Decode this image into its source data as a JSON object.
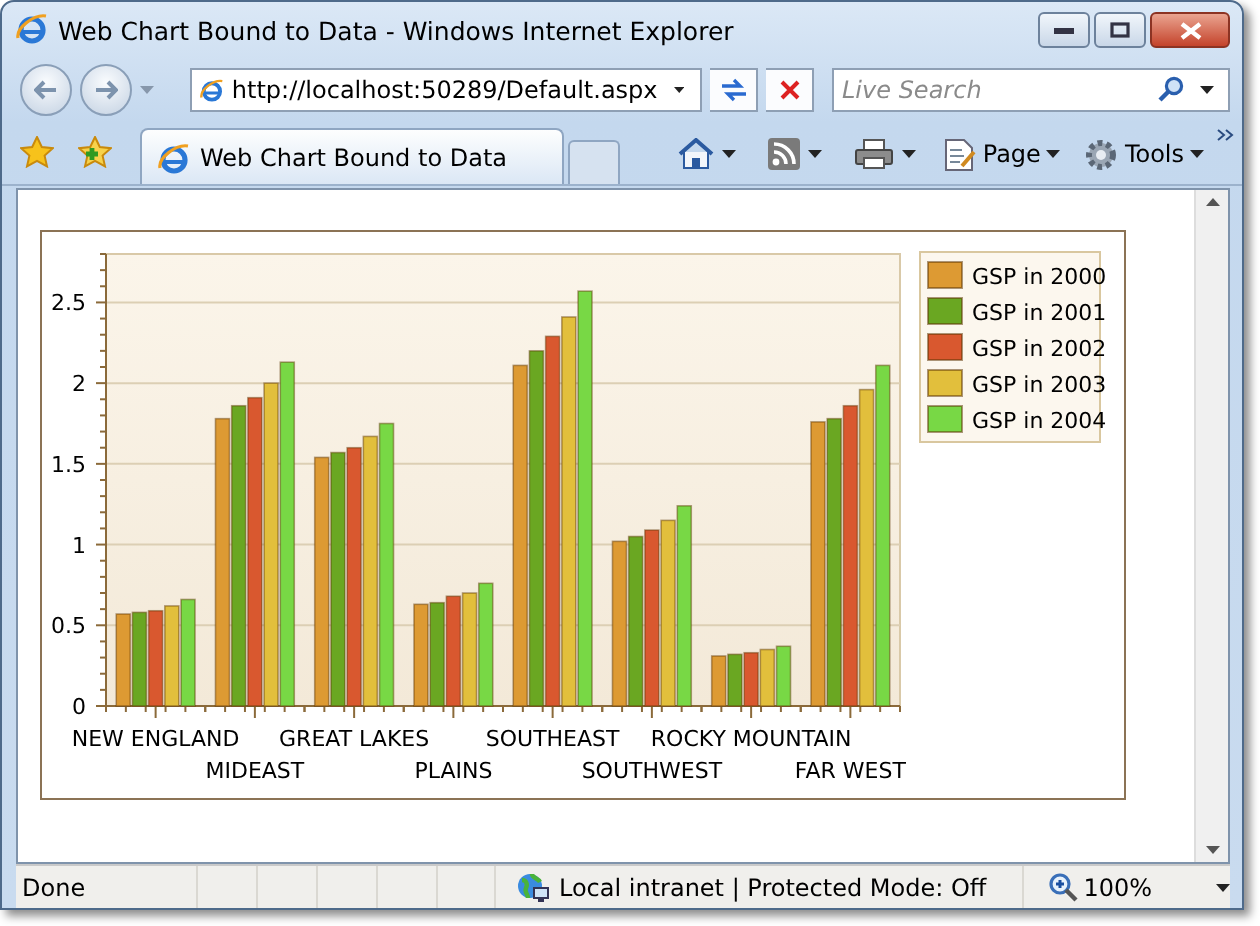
{
  "window": {
    "title": "Web Chart Bound to Data - Windows Internet Explorer"
  },
  "address_bar": {
    "url": "http://localhost:50289/Default.aspx"
  },
  "search": {
    "placeholder": "Live Search"
  },
  "tabs": [
    {
      "label": "Web Chart Bound to Data",
      "selected": true
    }
  ],
  "toolbar": [
    {
      "kind": "home"
    },
    {
      "kind": "feed"
    },
    {
      "kind": "print"
    },
    {
      "kind": "page",
      "label": "Page"
    },
    {
      "kind": "tools",
      "label": "Tools"
    }
  ],
  "chart": {
    "chart_data": {
      "type": "bar",
      "categories": [
        "NEW ENGLAND",
        "MIDEAST",
        "GREAT LAKES",
        "PLAINS",
        "SOUTHEAST",
        "SOUTHWEST",
        "ROCKY MOUNTAIN",
        "FAR WEST"
      ],
      "series": [
        {
          "name": "GSP in 2000",
          "color": "#dd9a33",
          "values": [
            0.57,
            1.78,
            1.54,
            0.63,
            2.11,
            1.02,
            0.31,
            1.76
          ]
        },
        {
          "name": "GSP in 2001",
          "color": "#6aa722",
          "values": [
            0.58,
            1.86,
            1.57,
            0.64,
            2.2,
            1.05,
            0.32,
            1.78
          ]
        },
        {
          "name": "GSP in 2002",
          "color": "#d9582f",
          "values": [
            0.59,
            1.91,
            1.6,
            0.68,
            2.29,
            1.09,
            0.33,
            1.86
          ]
        },
        {
          "name": "GSP in 2003",
          "color": "#e2bf3c",
          "values": [
            0.62,
            2.0,
            1.67,
            0.7,
            2.41,
            1.15,
            0.35,
            1.96
          ]
        },
        {
          "name": "GSP in 2004",
          "color": "#78d845",
          "values": [
            0.66,
            2.13,
            1.75,
            0.76,
            2.57,
            1.24,
            0.37,
            2.11
          ]
        }
      ],
      "ylim": [
        0,
        2.8
      ],
      "grid": true,
      "legend": true,
      "yticks": [
        {
          "value": 0,
          "label": "0"
        },
        {
          "value": 0.5,
          "label": "0.5"
        },
        {
          "value": 1,
          "label": "1"
        },
        {
          "value": 1.5,
          "label": "1.5"
        },
        {
          "value": 2,
          "label": "2"
        },
        {
          "value": 2.5,
          "label": "2.5"
        }
      ]
    }
  },
  "status_bar": {
    "status": "Done",
    "zone": "Local intranet | Protected Mode: Off",
    "zoom": "100%"
  }
}
